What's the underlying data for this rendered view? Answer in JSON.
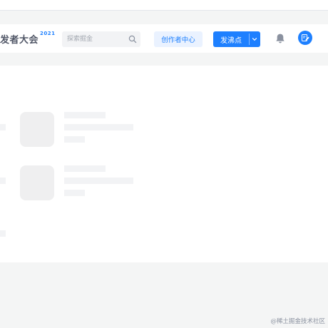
{
  "header": {
    "brand": {
      "text": "发者大会",
      "badge": "2021"
    },
    "search": {
      "placeholder": "探索掘金",
      "icon": "search-icon"
    },
    "creator_center_label": "创作者中心",
    "publish_pin": {
      "label": "发沸点",
      "dropdown_icon": "chevron-down-icon"
    },
    "notification_icon": "bell-icon",
    "avatar_icon": "edit-icon"
  },
  "feed": {
    "state": "loading-skeleton",
    "placeholder_items": 2
  },
  "watermark": "@稀土掘金技术社区",
  "colors": {
    "accent": "#1e80ff",
    "accent_light": "#eaf2ff",
    "skeleton": "#f2f3f5",
    "page_bg": "#f4f5f5"
  }
}
